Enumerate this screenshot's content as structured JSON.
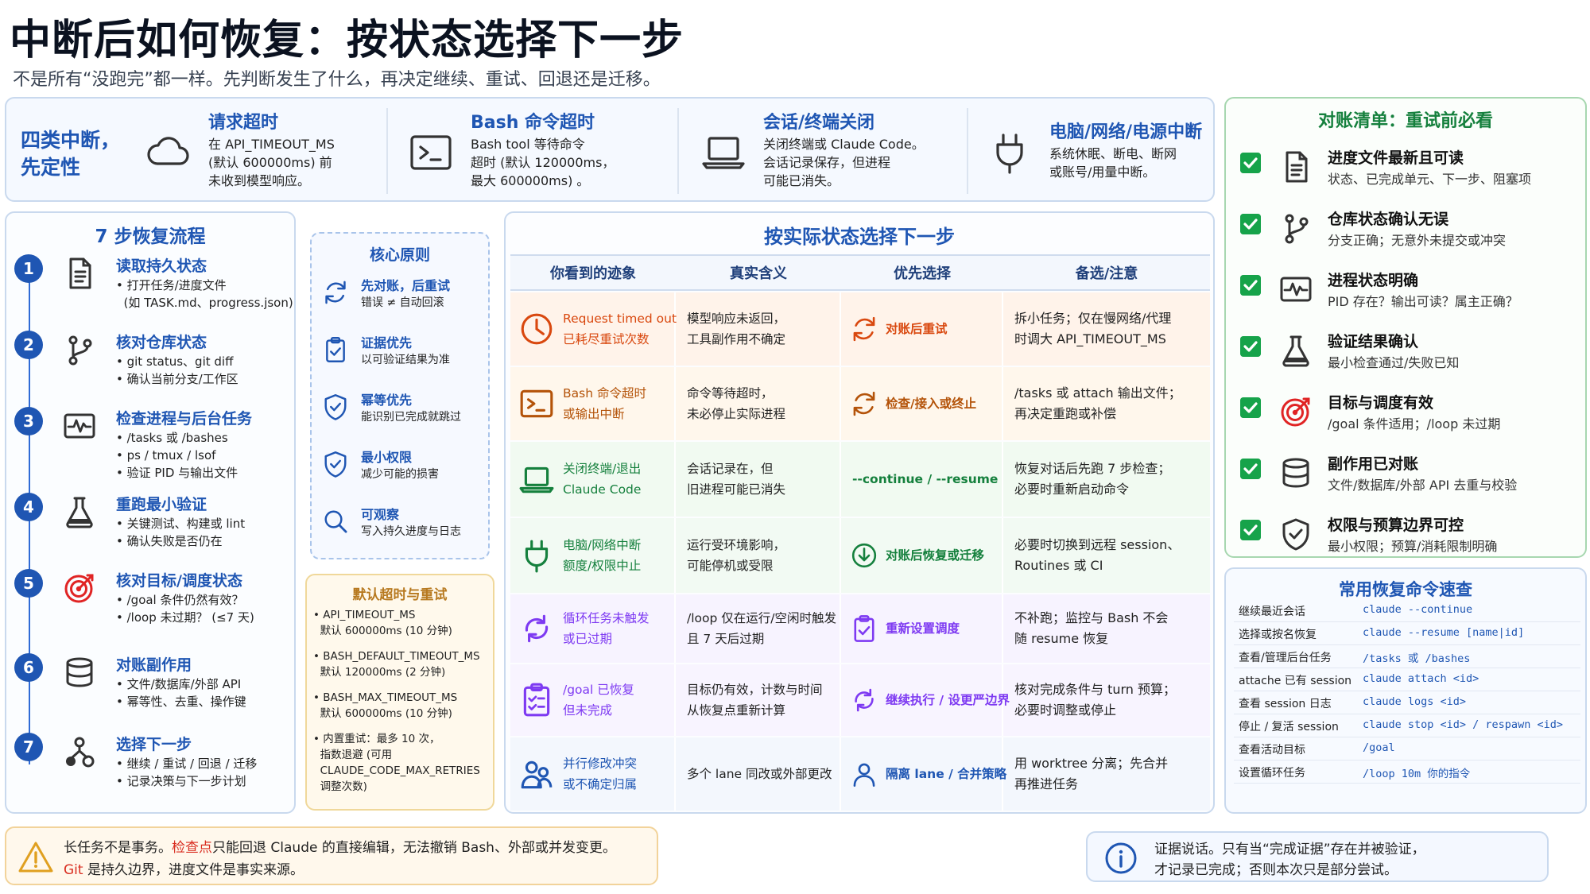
{
  "header": {
    "title": "中断后如何恢复：按状态选择下一步",
    "subtitle": "不是所有“没跑完”都一样。先判断发生了什么，再决定继续、重试、回退还是迁移。"
  },
  "interruptions": {
    "lead_line1": "四类中断，",
    "lead_line2": "先定性",
    "items": [
      {
        "icon": "cloud-icon",
        "title": "请求超时",
        "desc": "在 API_TIMEOUT_MS\n(默认 600000ms) 前\n未收到模型响应。"
      },
      {
        "icon": "terminal-icon",
        "title": "Bash 命令超时",
        "desc": "Bash tool 等待命令\n超时 (默认 120000ms，\n最大 600000ms) 。"
      },
      {
        "icon": "laptop-icon",
        "title": "会话/终端关闭",
        "desc": "关闭终端或 Claude Code。\n会话记录保存，但进程\n可能已消失。"
      },
      {
        "icon": "power-plug-icon",
        "title": "电脑/网络/电源中断",
        "desc": "系统休眠、断电、断网\n或账号/用量中断。"
      }
    ]
  },
  "checklist": {
    "title": "对账清单：重试前必看",
    "items": [
      {
        "icon": "document-icon",
        "title": "进度文件最新且可读",
        "desc": "状态、已完成单元、下一步、阻塞项"
      },
      {
        "icon": "git-branch-icon",
        "title": "仓库状态确认无误",
        "desc": "分支正确；无意外未提交或冲突"
      },
      {
        "icon": "pulse-icon",
        "title": "进程状态明确",
        "desc": "PID 存在？输出可读？属主正确？"
      },
      {
        "icon": "flask-icon",
        "title": "验证结果确认",
        "desc": "最小检查通过/失败已知"
      },
      {
        "icon": "target-icon",
        "title": "目标与调度有效",
        "desc": "/goal 条件适用；/loop 未过期"
      },
      {
        "icon": "database-icon",
        "title": "副作用已对账",
        "desc": "文件/数据库/外部 API 去重与校验"
      },
      {
        "icon": "shield-check-icon",
        "title": "权限与预算边界可控",
        "desc": "最小权限；预算/消耗限制明确"
      }
    ]
  },
  "steps": {
    "title": "7 步恢复流程",
    "items": [
      {
        "num": "1",
        "icon": "document-icon",
        "title": "读取持久状态",
        "desc": "• 打开任务/进度文件\n  (如 TASK.md、progress.json)"
      },
      {
        "num": "2",
        "icon": "git-branch-icon",
        "title": "核对仓库状态",
        "desc": "• git status、git diff\n• 确认当前分支/工作区"
      },
      {
        "num": "3",
        "icon": "pulse-icon",
        "title": "检查进程与后台任务",
        "desc": "• /tasks 或 /bashes\n• ps / tmux / lsof\n• 验证 PID 与输出文件"
      },
      {
        "num": "4",
        "icon": "flask-icon",
        "title": "重跑最小验证",
        "desc": "• 关键测试、构建或 lint\n• 确认失败是否仍在"
      },
      {
        "num": "5",
        "icon": "target-icon",
        "title": "核对目标/调度状态",
        "desc": "• /goal 条件仍然有效？\n• /loop 未过期？ (≤7 天)"
      },
      {
        "num": "6",
        "icon": "database-icon",
        "title": "对账副作用",
        "desc": "• 文件/数据库/外部 API\n• 幂等性、去重、操作键"
      },
      {
        "num": "7",
        "icon": "fork-icon",
        "title": "选择下一步",
        "desc": "• 继续 / 重试 / 回退 / 迁移\n• 记录决策与下一步计划"
      }
    ]
  },
  "principles": {
    "title": "核心原则",
    "items": [
      {
        "icon": "refresh-icon",
        "title": "先对账，后重试",
        "desc": "错误 ≠ 自动回滚"
      },
      {
        "icon": "clipboard-check-icon",
        "title": "证据优先",
        "desc": "以可验证结果为准"
      },
      {
        "icon": "shield-check-icon",
        "title": "幂等优先",
        "desc": "能识别已完成就跳过"
      },
      {
        "icon": "shield-check-icon",
        "title": "最小权限",
        "desc": "减少可能的损害"
      },
      {
        "icon": "search-icon",
        "title": "可观察",
        "desc": "写入持久进度与日志"
      }
    ]
  },
  "timeouts": {
    "title": "默认超时与重试",
    "items": [
      "• API_TIMEOUT_MS\n  默认 600000ms (10 分钟)",
      "• BASH_DEFAULT_TIMEOUT_MS\n  默认 120000ms (2 分钟)",
      "• BASH_MAX_TIMEOUT_MS\n  默认 600000ms (10 分钟)",
      "• 内置重试：最多 10 次，\n  指数退避 (可用\n  CLAUDE_CODE_MAX_RETRIES\n  调整次数)"
    ]
  },
  "state_table": {
    "title": "按实际状态选择下一步",
    "headers": [
      "你看到的迹象",
      "真实含义",
      "优先选择",
      "备选/注意"
    ],
    "rows": [
      {
        "sign_icon": "clock-icon",
        "sign": "Request timed out\n已耗尽重试次数",
        "meaning": "模型响应未返回，\n工具副作用不确定",
        "action_icon": "refresh-icon",
        "action": "对账后重试",
        "note": "拆小任务；仅在慢网络/代理\n时调大 API_TIMEOUT_MS",
        "color": "#d9480f",
        "bg": "#fff3ea"
      },
      {
        "sign_icon": "terminal-icon",
        "sign": "Bash 命令超时\n或输出中断",
        "meaning": "命令等待超时，\n未必停止实际进程",
        "action_icon": "refresh-icon",
        "action": "检查/接入或终止",
        "note": "/tasks 或 attach 输出文件；\n再决定重跑或补偿",
        "color": "#b45309",
        "bg": "#fff7ec"
      },
      {
        "sign_icon": "laptop-icon",
        "sign": "关闭终端/退出\nClaude Code",
        "meaning": "会话记录在，但\n旧进程可能已消失",
        "action_icon": "",
        "action": "--continue / --resume",
        "note": "恢复对话后先跑 7 步检查；\n必要时重新启动命令",
        "color": "#15803d",
        "bg": "#f1faf1"
      },
      {
        "sign_icon": "power-plug-icon",
        "sign": "电脑/网络中断\n额度/权限中止",
        "meaning": "运行受环境影响，\n可能停机或受限",
        "action_icon": "download-circle-icon",
        "action": "对账后恢复或迁移",
        "note": "必要时切换到远程 session、\nRoutines 或 CI",
        "color": "#15803d",
        "bg": "#f2faf3"
      },
      {
        "sign_icon": "loop-icon",
        "sign": "循环任务未触发\n或已过期",
        "meaning": "/loop 仅在运行/空闲时触发\n且 7 天后过期",
        "action_icon": "clipboard-check-icon",
        "action": "重新设置调度",
        "note": "不补跑；监控与 Bash 不会\n随 resume 恢复",
        "color": "#7e3af2",
        "bg": "#f7f3ff"
      },
      {
        "sign_icon": "checklist-icon",
        "sign": "/goal 已恢复\n但未完成",
        "meaning": "目标仍有效，计数与时间\n从恢复点重新计算",
        "action_icon": "loop-icon",
        "action": "继续执行 / 设更严边界",
        "note": "核对完成条件与 turn 预算；\n必要时调整或停止",
        "color": "#7e3af2",
        "bg": "#f8f4ff"
      },
      {
        "sign_icon": "users-icon",
        "sign": "并行修改冲突\n或不确定归属",
        "meaning": "多个 lane 同改或外部更改",
        "action_icon": "user-icon",
        "action": "隔离 lane / 合并策略",
        "note": "用 worktree 分离；先合并\n再推进任务",
        "color": "#1f56b3",
        "bg": "#f3f7fd"
      }
    ]
  },
  "commands": {
    "title": "常用恢复命令速查",
    "items": [
      {
        "label": "继续最近会话",
        "cmd": "claude --continue"
      },
      {
        "label": "选择或按名恢复",
        "cmd": "claude --resume [name|id]"
      },
      {
        "label": "查看/管理后台任务",
        "cmd": "/tasks 或 /bashes"
      },
      {
        "label": "attache 已有 session",
        "cmd": "claude attach <id>"
      },
      {
        "label": "查看 session 日志",
        "cmd": "claude logs <id>"
      },
      {
        "label": "停止 / 复活 session",
        "cmd": "claude stop <id> / respawn <id>"
      },
      {
        "label": "查看活动目标",
        "cmd": "/goal"
      },
      {
        "label": "设置循环任务",
        "cmd": "/loop 10m 你的指令"
      }
    ]
  },
  "footer": {
    "warn_a": "长任务不是事务。",
    "warn_b": "检查点",
    "warn_c": "只能回退 Claude 的直接编辑，无法撤销 Bash、外部或并发变更。",
    "warn_d": "Git",
    "warn_e": " 是持久边界，进度文件是事实来源。",
    "info_1": "证据说话。只有当“完成证据”存在并被验证，",
    "info_2": "才记录已完成；否则本次只是部分尝试。"
  }
}
